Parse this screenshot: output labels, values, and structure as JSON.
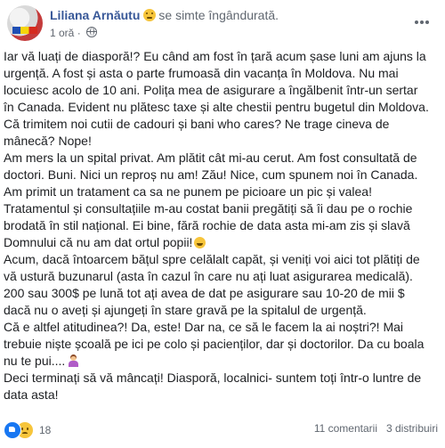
{
  "post": {
    "author": "Liliana Arnăutu",
    "feeling": "se simte îngândurată.",
    "time": "1 oră",
    "paragraphs": [
      "Iar vă luați de diasporă!? Eu când am fost în țară acum șase luni am ajuns la urgență. A fost și asta o parte frumoasă din vacanța în Moldova. Nu mai locuiesc acolo de 10 ani. Polița mea de asigurare a îngălbenit într-un sertar în Canada. Evident nu plătesc taxe și alte chestii pentru bugetul din Moldova. Că trimitem noi cutii de cadouri și bani who cares? Ne trage cineva de mânecă? Nope!",
      "Am mers la un spital privat. Am plătit cât mi-au cerut. Am fost consultată de doctori. Buni. Nici un reproș nu am! Zău! Nice, cum spunem noi în Canada. Am primit un tratament ca sa ne punem pe picioare un pic și valea!",
      "Tratamentul și consultațiile m-au costat banii pregătiți să îi dau pe o rochie brodată în stil național. Ei bine, fără rochie de data asta mi-am zis și slavă Domnului că nu am dat ortul popii!",
      "Acum, dacă întoarcem bățul spre celălalt capăt, și veniți voi aici tot plătiți de vă ustură buzunarul (asta în cazul în care nu ați luat asigurarea medicală). 200 sau 300$ pe lună tot ați avea de dat pe asigurare sau 10-20 de mii $ dacă nu o aveți și ajungeți în stare gravă pe la spitalul de urgență.",
      "Că e altfel atitudinea?! Da, este! Dar na, ce să le facem la ai noștri?! Mai trebuie niște școală pe ici pe colo și pacienților, dar și doctorilor. Da cu boala nu te pui....",
      "Deci terminați să vă mâncați! Diasporă, localnici- suntem toți într-o luntre de data asta!"
    ]
  },
  "footer": {
    "reactions": "18",
    "comments": "11 comentarii",
    "shares": "3 distribuiri"
  }
}
